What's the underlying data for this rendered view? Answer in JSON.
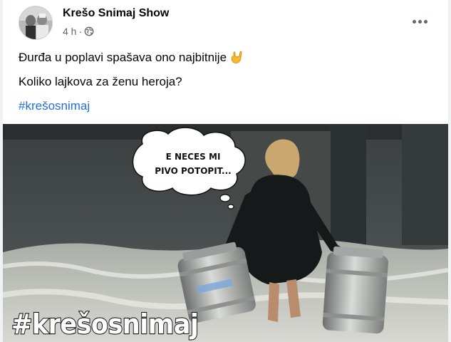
{
  "post": {
    "page_name": "Krešo Snimaj Show",
    "time": "4 h",
    "separator": "·",
    "audience_icon": "globe-icon",
    "more_icon": "more-horizontal-icon",
    "lines": [
      "Đurđa u poplavi spašava ono najbitnije",
      "Koliko lajkova za ženu heroja?"
    ],
    "emoji": "sign-of-the-horns-emoji",
    "hashtag": "#krešosnimaj"
  },
  "image": {
    "bubble_line1": "E NECES MI",
    "bubble_line2": "PIVO POTOPIT...",
    "watermark": "#krešosnimaj"
  },
  "colors": {
    "link": "#216fdb",
    "secondary_text": "#65676b",
    "background": "#ffffff"
  }
}
